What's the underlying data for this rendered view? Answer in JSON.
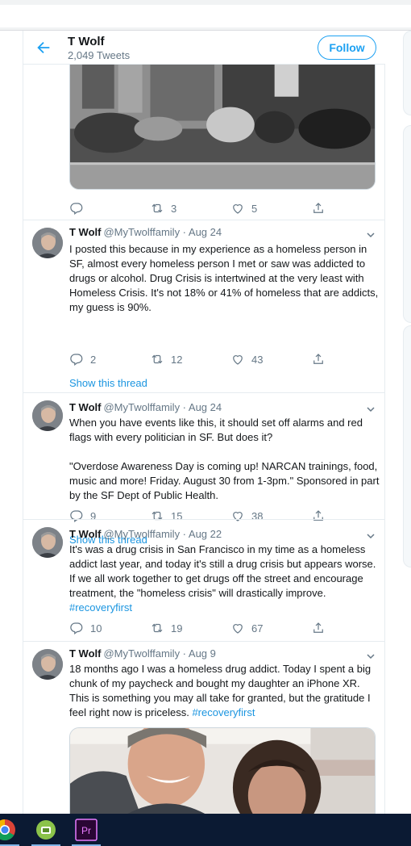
{
  "header": {
    "name": "T Wolf",
    "tweet_count": "2,049 Tweets",
    "follow_label": "Follow"
  },
  "first_tweet_actions": {
    "reply": "",
    "retweet": "3",
    "like": "5"
  },
  "tweets": [
    {
      "name": "T Wolf",
      "meta": "@MyTwolffamily · Aug 24",
      "paragraphs": [
        "I posted this because in my experience as a homeless person in SF, almost every homeless person I met or saw was addicted to drugs or alcohol.  Drug Crisis is intertwined at the very least with Homeless Crisis. It's not 18% or 41% of homeless that are addicts,  my guess is 90%."
      ],
      "hashtag": "",
      "reply": "2",
      "retweet": "12",
      "like": "43",
      "thread_link": "Show this thread"
    },
    {
      "name": "T Wolf",
      "meta": "@MyTwolffamily · Aug 24",
      "paragraphs": [
        "When you have events like this, it should set off alarms and red flags with every politician in SF. But does it?",
        "\"Overdose Awareness Day is coming up! NARCAN trainings, food, music and more! Friday. August 30 from 1-3pm.\" Sponsored in part by the SF Dept of Public Health."
      ],
      "hashtag": "",
      "reply": "9",
      "retweet": "15",
      "like": "38",
      "thread_link": "Show this thread"
    },
    {
      "name": "T Wolf",
      "meta": "@MyTwolffamily · Aug 22",
      "paragraphs": [
        "It's was a drug crisis in San Francisco in my time as a homeless addict last year, and today it's still a drug crisis but appears worse. If we all work together to get drugs off the street and encourage treatment,  the \"homeless crisis\" will drastically improve. "
      ],
      "hashtag": "#recoveryfirst",
      "reply": "10",
      "retweet": "19",
      "like": "67",
      "thread_link": ""
    },
    {
      "name": "T Wolf",
      "meta": "@MyTwolffamily · Aug 9",
      "paragraphs": [
        "18 months ago I was a homeless drug addict. Today I spent a big chunk of my paycheck and bought my daughter an iPhone XR. This is something you may all take for granted, but the gratitude I feel right now is priceless.  "
      ],
      "hashtag": "#recoveryfirst",
      "reply": "",
      "retweet": "",
      "like": "",
      "thread_link": ""
    }
  ],
  "taskbar": {
    "apps": [
      "chrome-icon",
      "app-green-icon",
      "premiere-pro-icon"
    ],
    "premiere_label": "Pr"
  },
  "colors": {
    "accent": "#1da1f2",
    "link": "#1b95e0",
    "muted": "#657786",
    "taskbar": "#0b1a33"
  }
}
